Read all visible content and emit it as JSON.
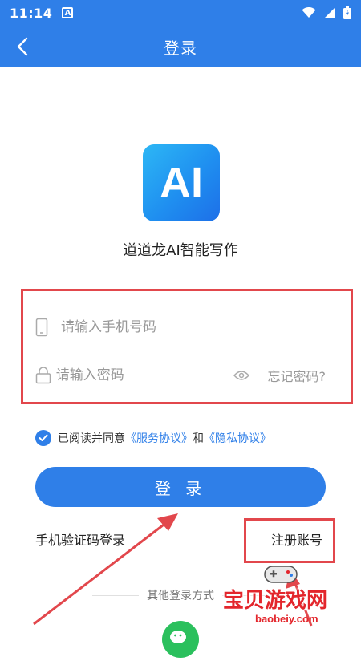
{
  "statusbar": {
    "time": "11:14",
    "notification_letter": "A"
  },
  "nav": {
    "title": "登录"
  },
  "app": {
    "logo_text": "AI",
    "name": "道道龙AI智能写作"
  },
  "form": {
    "phone_placeholder": "请输入手机号码",
    "password_placeholder": "请输入密码",
    "forgot_label": "忘记密码?"
  },
  "agreement": {
    "prefix": "已阅读并同意",
    "service_link": "《服务协议》",
    "and": "和",
    "privacy_link": "《隐私协议》"
  },
  "actions": {
    "login_label": "登 录",
    "sms_login_label": "手机验证码登录",
    "register_label": "注册账号"
  },
  "other": {
    "label": "其他登录方式"
  },
  "watermark": {
    "title": "宝贝游戏网",
    "url": "baobeiy.com"
  },
  "colors": {
    "primary": "#2f7fe8",
    "highlight_red": "#e2474c",
    "wechat_green": "#2bc05d"
  }
}
